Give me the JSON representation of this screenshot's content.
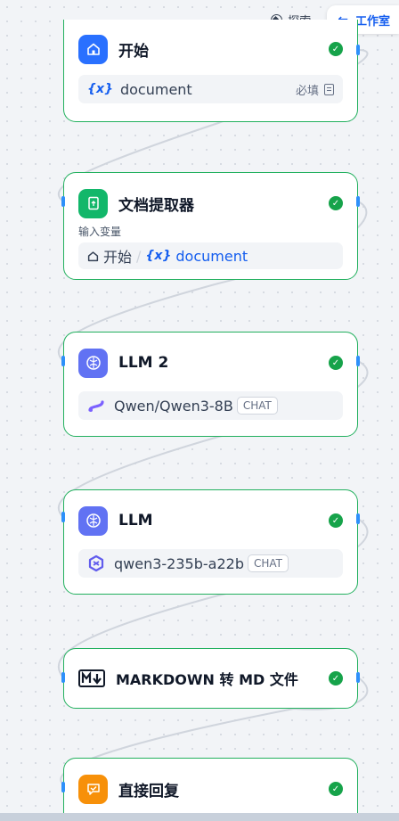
{
  "topbar": {
    "explore_label": "探索",
    "workbench_label": "工作室",
    "back_arrow": "←"
  },
  "colors": {
    "node_border": "#22b05e",
    "handle": "#2e90fa",
    "accent": "#155eef"
  },
  "nodes": [
    {
      "title": "开始",
      "icon": "home-icon",
      "badge_color": "#2970ff",
      "status": "success",
      "field": {
        "var_symbol": "{x}",
        "name": "document",
        "required_label": "必填"
      }
    },
    {
      "title": "文档提取器",
      "icon": "document-extractor-icon",
      "badge_color": "#12b76a",
      "status": "success",
      "input_label": "输入变量",
      "field": {
        "source": "开始",
        "separator": "/",
        "var_symbol": "{x}",
        "name": "document"
      }
    },
    {
      "title": "LLM 2",
      "icon": "llm-brain-icon",
      "badge_color": "#6172f3",
      "status": "success",
      "model": {
        "name": "Qwen/Qwen3-8B",
        "tag": "CHAT",
        "icon": "siliconflow-icon"
      }
    },
    {
      "title": "LLM",
      "icon": "llm-brain-icon",
      "badge_color": "#6172f3",
      "status": "success",
      "model": {
        "name": "qwen3-235b-a22b",
        "tag": "CHAT",
        "icon": "qwen-icon"
      }
    },
    {
      "title": "MARKDOWN 转 MD 文件",
      "icon": "markdown-icon",
      "status": "success"
    },
    {
      "title": "直接回复",
      "icon": "reply-icon",
      "badge_color": "#f79009",
      "status": "success"
    }
  ]
}
